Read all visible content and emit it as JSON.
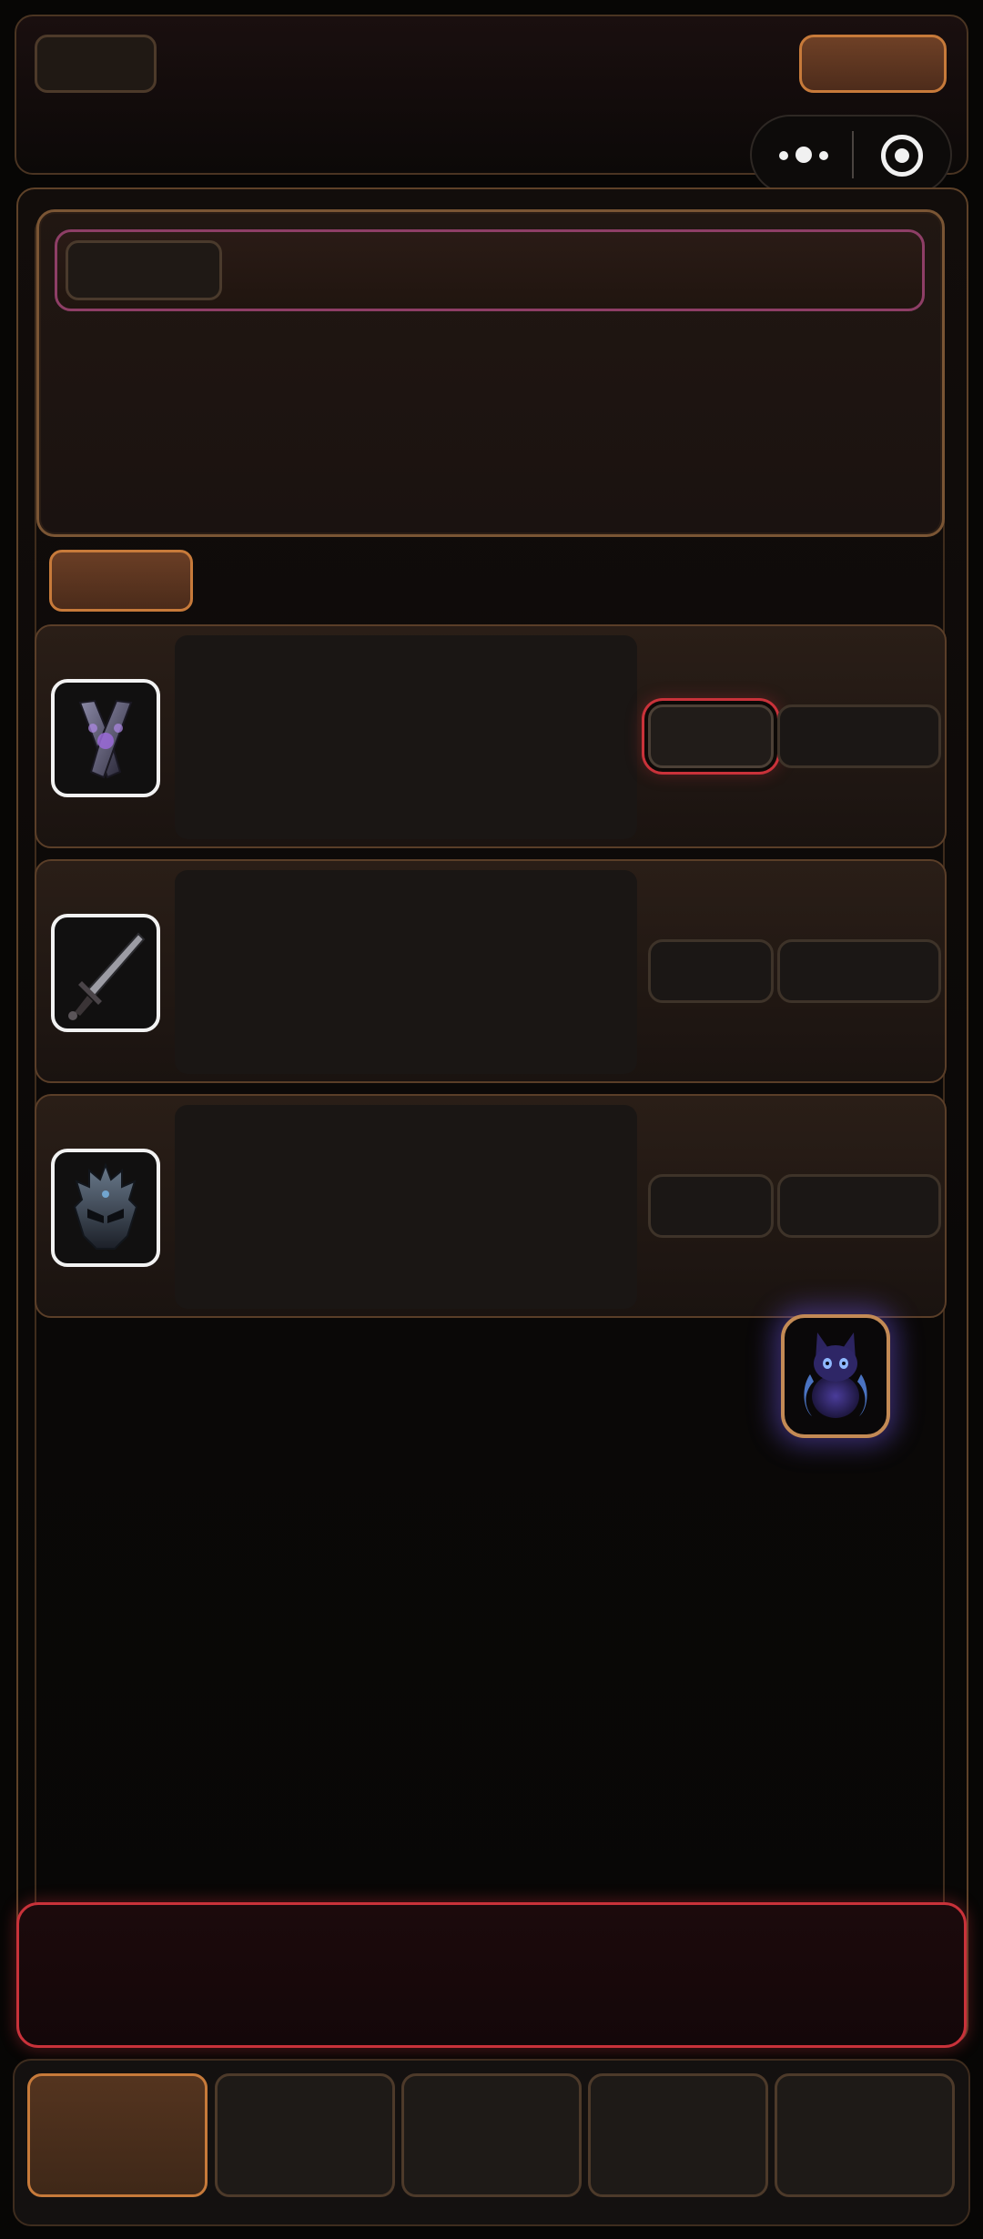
{
  "header": {
    "left_button_icon": "",
    "right_button_icon": "",
    "capsule": {
      "more_icon": "more-dots-icon",
      "target_icon": "target-icon"
    }
  },
  "profile_card": {},
  "items": [
    {
      "icon": "gauntlets-icon",
      "active": true
    },
    {
      "icon": "sword-icon",
      "active": false
    },
    {
      "icon": "helmet-icon",
      "active": false
    }
  ],
  "pet": {
    "icon": "cat-pet-icon"
  },
  "nav": {
    "tabs": 5,
    "active_index": 0
  },
  "colors": {
    "accent": "#c77a3a",
    "alert": "#c9323a",
    "banner": "#8e3e66",
    "pet_glow": "#6e56e6"
  }
}
